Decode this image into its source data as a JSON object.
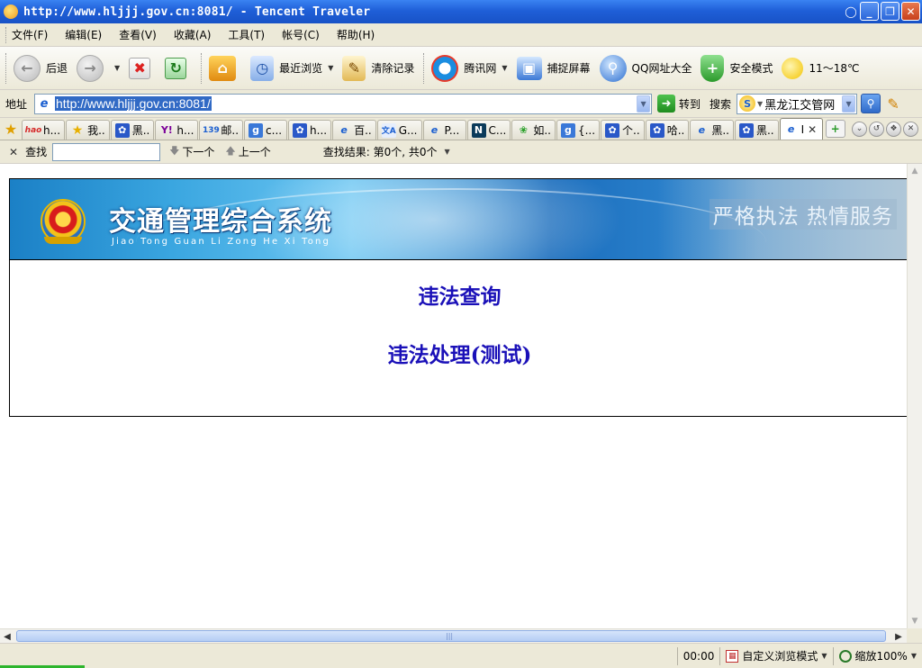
{
  "window": {
    "title": "http://www.hljjj.gov.cn:8081/ - Tencent Traveler"
  },
  "menubar": {
    "items": [
      "文件(F)",
      "编辑(E)",
      "查看(V)",
      "收藏(A)",
      "工具(T)",
      "帐号(C)",
      "帮助(H)"
    ]
  },
  "toolbar": {
    "back": "后退",
    "recent": "最近浏览",
    "clear_history": "清除记录",
    "tencent_net": "腾讯网",
    "capture_screen": "捕捉屏幕",
    "qq_nav": "QQ网址大全",
    "safe_mode": "安全模式",
    "weather": "11～18℃"
  },
  "addressbar": {
    "label": "地址",
    "url": "http://www.hljjj.gov.cn:8081/",
    "go": "转到",
    "search_label": "搜索",
    "search_value": "黑龙江交管网"
  },
  "tabs": [
    {
      "label": "h...",
      "icon": "hao-icon"
    },
    {
      "label": "我..",
      "icon": "star-icon"
    },
    {
      "label": "黑..",
      "icon": "baidu-paw-icon"
    },
    {
      "label": "h...",
      "icon": "yahoo-icon"
    },
    {
      "label": "邮..",
      "icon": "mail-139-icon"
    },
    {
      "label": "c...",
      "icon": "google-icon"
    },
    {
      "label": "h...",
      "icon": "baidu-paw-icon"
    },
    {
      "label": "百..",
      "icon": "ie-page-icon"
    },
    {
      "label": "G...",
      "icon": "translate-icon"
    },
    {
      "label": "P...",
      "icon": "ie-page-icon"
    },
    {
      "label": "C...",
      "icon": "n-logo-icon"
    },
    {
      "label": "如..",
      "icon": "leaf-icon"
    },
    {
      "label": "{...",
      "icon": "google-icon"
    },
    {
      "label": "个..",
      "icon": "baidu-paw-icon"
    },
    {
      "label": "哈..",
      "icon": "baidu-paw-icon"
    },
    {
      "label": "黑..",
      "icon": "ie-page-icon"
    },
    {
      "label": "黑..",
      "icon": "baidu-paw-icon"
    },
    {
      "label": "I",
      "icon": "ie-page-icon",
      "active": true
    }
  ],
  "findbar": {
    "label": "查找",
    "query": "",
    "next": "下一个",
    "prev": "上一个",
    "result": "查找结果: 第0个, 共0个"
  },
  "page": {
    "banner_title": "交通管理综合系统",
    "banner_pinyin": "Jiao Tong Guan Li Zong He Xi Tong",
    "banner_slogan": "严格执法  热情服务",
    "links": [
      {
        "label": "违法查询"
      },
      {
        "label": "违法处理(测试)"
      }
    ],
    "link_color": "#1a10b8"
  },
  "statusbar": {
    "time": "00:00",
    "browse_mode": "自定义浏览模式",
    "zoom": "缩放100%"
  }
}
